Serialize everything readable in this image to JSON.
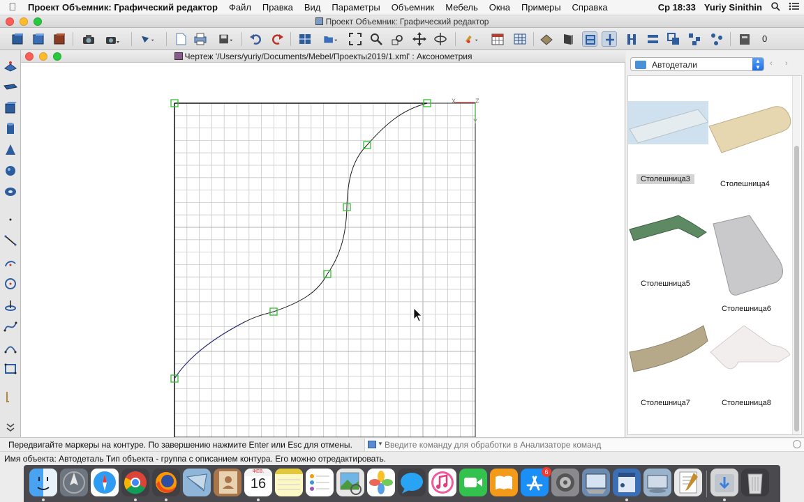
{
  "menubar": {
    "app_name": "Проект Объемник: Графический редактор",
    "items": [
      "Файл",
      "Правка",
      "Вид",
      "Параметры",
      "Объемник",
      "Мебель",
      "Окна",
      "Примеры",
      "Справка"
    ],
    "clock": "Ср 18:33",
    "user": "Yuriy Sinithin"
  },
  "window": {
    "title": "Проект Объемник: Графический редактор"
  },
  "toolbar": {
    "counter": "0"
  },
  "document": {
    "title": "Чертеж '/Users/yuriy/Documents/Mebel/Проекты2019/1.xml' : Аксонометрия",
    "axis_x": "X",
    "axis_y": "Y",
    "axis_z": "Z"
  },
  "library": {
    "selected": "Автодетали",
    "items": [
      {
        "label": "Столешница3",
        "selected": true
      },
      {
        "label": "Столешница4",
        "selected": false
      },
      {
        "label": "Столешница5",
        "selected": false
      },
      {
        "label": "Столешница6",
        "selected": false
      },
      {
        "label": "Столешница7",
        "selected": false
      },
      {
        "label": "Столешница8",
        "selected": false
      }
    ]
  },
  "status": {
    "hint": "Передвигайте маркеры на контуре. По завершению нажмите Enter или Esc для отмены.",
    "command_placeholder": "Введите команду для обработки в Анализаторе команд",
    "info": "Имя объекта: Автодеталь Тип объекта - группа с описанием контура. Его можно отредактировать."
  },
  "dock": {
    "calendar_month": "ФЕВ.",
    "calendar_day": "16",
    "appstore_badge": "6",
    "icons": [
      "finder-icon",
      "launchpad-icon",
      "safari-icon",
      "chrome-icon",
      "firefox-icon",
      "mail-icon",
      "contacts-icon",
      "calendar-icon",
      "notes-icon",
      "reminders-icon",
      "preview-icon",
      "photos-icon",
      "messages-icon",
      "itunes-icon",
      "facetime-icon",
      "books-icon",
      "appstore-icon",
      "system-preferences-icon",
      "image-capture-icon",
      "objemnik-icon",
      "network-icon",
      "textedit-icon",
      "downloads-icon",
      "trash-icon"
    ]
  },
  "colors": {
    "marker": "#2fc12f",
    "curve": "#1b1b1b",
    "grid": "#c8c8c8",
    "selection": "#d4d4d4"
  }
}
